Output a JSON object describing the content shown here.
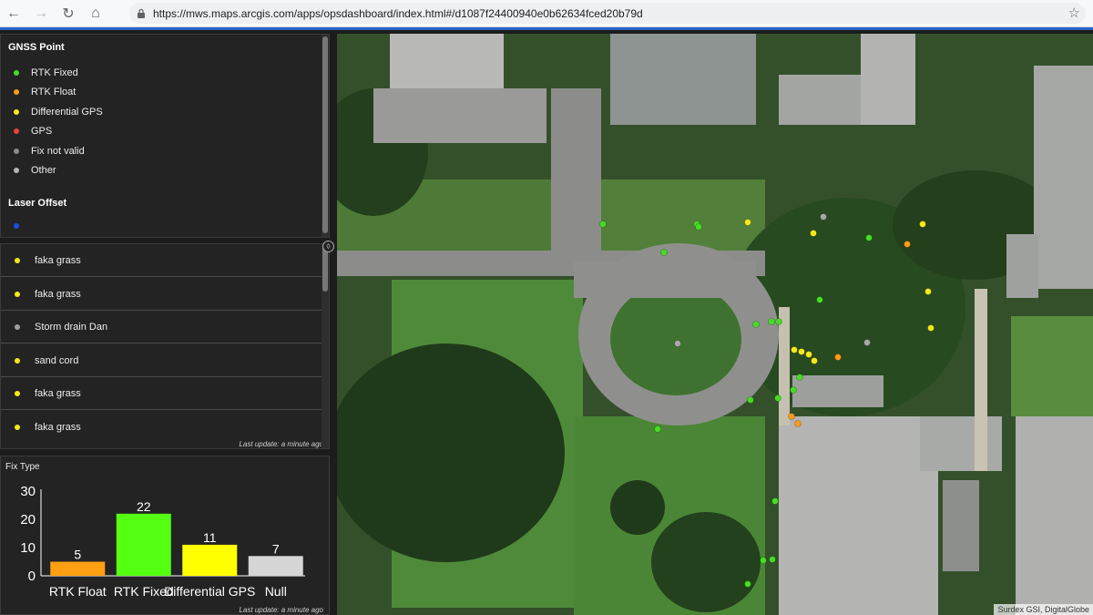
{
  "browser": {
    "url": "https://mws.maps.arcgis.com/apps/opsdashboard/index.html#/d1087f24400940e0b62634fced20b79d"
  },
  "legend": {
    "title": "GNSS Point",
    "items": [
      {
        "label": "RTK Fixed",
        "color": "#44dd22"
      },
      {
        "label": "RTK Float",
        "color": "#ff9a1a"
      },
      {
        "label": "Differential GPS",
        "color": "#f5e81c"
      },
      {
        "label": "GPS",
        "color": "#e8443a"
      },
      {
        "label": "Fix not valid",
        "color": "#8c8c8c"
      },
      {
        "label": "Other",
        "color": "#b4b4b4"
      }
    ],
    "laser_title": "Laser Offset",
    "laser_color": "#1a4fe0"
  },
  "list": {
    "items": [
      {
        "label": "faka grass",
        "color": "#f5e81c"
      },
      {
        "label": "faka grass",
        "color": "#f5e81c"
      },
      {
        "label": "Storm drain Dan",
        "color": "#a0a0a0"
      },
      {
        "label": "sand cord",
        "color": "#f5e81c"
      },
      {
        "label": "faka grass",
        "color": "#f5e81c"
      },
      {
        "label": "faka grass",
        "color": "#f5e81c"
      }
    ],
    "last_update": "Last update: a minute ago"
  },
  "chart": {
    "panel_title": "Fix Type",
    "last_update": "Last update: a minute ago"
  },
  "chart_data": {
    "type": "bar",
    "categories": [
      "RTK Float",
      "RTK Fixed",
      "Differential GPS",
      "Null"
    ],
    "values": [
      5,
      22,
      11,
      7
    ],
    "colors": [
      "#ff9f12",
      "#55ff11",
      "#ffff00",
      "#d6d6d6"
    ],
    "ylim": [
      0,
      30
    ],
    "yticks": [
      0,
      10,
      20,
      30
    ],
    "grid": false,
    "title": "",
    "xlabel": "",
    "ylabel": ""
  },
  "map": {
    "attribution": "Surdex GSI, DigitalGlobe",
    "points_colors": {
      "fixed": "#44dd22",
      "float": "#ff9a1a",
      "dgps": "#f5e81c",
      "other": "#a8a8a8"
    }
  }
}
